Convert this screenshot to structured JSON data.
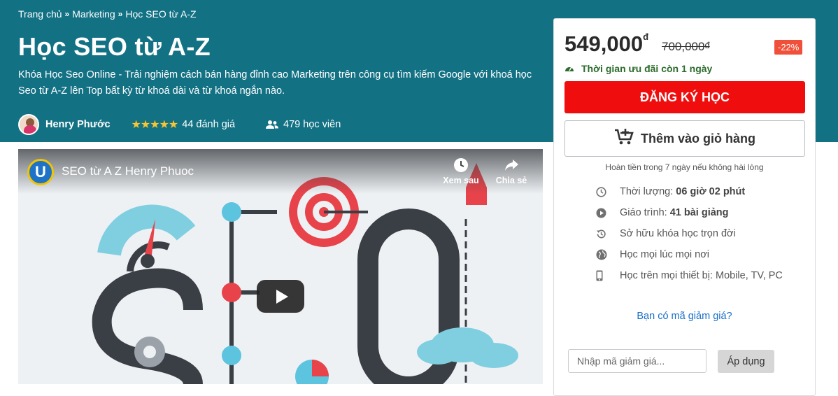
{
  "breadcrumb": {
    "items": [
      "Trang chủ",
      "Marketing",
      "Học SEO từ A-Z"
    ],
    "separator": "»"
  },
  "course": {
    "title": "Học SEO từ A-Z",
    "description": "Khóa Học Seo Online - Trải nghiệm cách bán hàng đỉnh cao Marketing trên công cụ tìm kiếm Google với khoá học Seo từ A-Z lên Top bất kỳ từ khoá dài và từ khoá ngắn nào.",
    "author": "Henry Phước",
    "stars": "★★★★★",
    "rating_value": 5,
    "rating_count": "44 đánh giá",
    "students": "479 học viên"
  },
  "video": {
    "channel_letter": "U",
    "title": "SEO từ A Z Henry Phuoc",
    "watch_later": "Xem sau",
    "share": "Chia sẻ"
  },
  "pricing": {
    "price": "549,000",
    "old_price": "700,000",
    "currency": "đ",
    "discount": "-22%",
    "timer": "Thời gian ưu đãi còn 1 ngày",
    "register_label": "ĐĂNG KÝ HỌC",
    "cart_label": "Thêm vào giỏ hàng",
    "refund": "Hoàn tiền trong 7 ngày nếu không hài lòng"
  },
  "features": [
    {
      "icon": "clock-icon",
      "label": "Thời lượng:",
      "value": "06 giờ 02 phút"
    },
    {
      "icon": "play-circle-icon",
      "label": "Giáo trình:",
      "value": "41 bài giảng"
    },
    {
      "icon": "history-icon",
      "label": "Sở hữu khóa học trọn đời",
      "value": ""
    },
    {
      "icon": "globe-icon",
      "label": "Học mọi lúc mọi nơi",
      "value": ""
    },
    {
      "icon": "mobile-icon",
      "label": "Học trên mọi thiết bị: Mobile, TV, PC",
      "value": ""
    }
  ],
  "coupon": {
    "link": "Bạn có mã giảm giá?",
    "placeholder": "Nhập mã giảm giá...",
    "apply_label": "Áp dụng"
  },
  "colors": {
    "hero_bg": "#137184",
    "register_bg": "#f00d0d",
    "discount_bg": "#f0503a",
    "timer_text": "#2c6b2b",
    "star": "#f7c531",
    "link": "#1a6fc9"
  }
}
